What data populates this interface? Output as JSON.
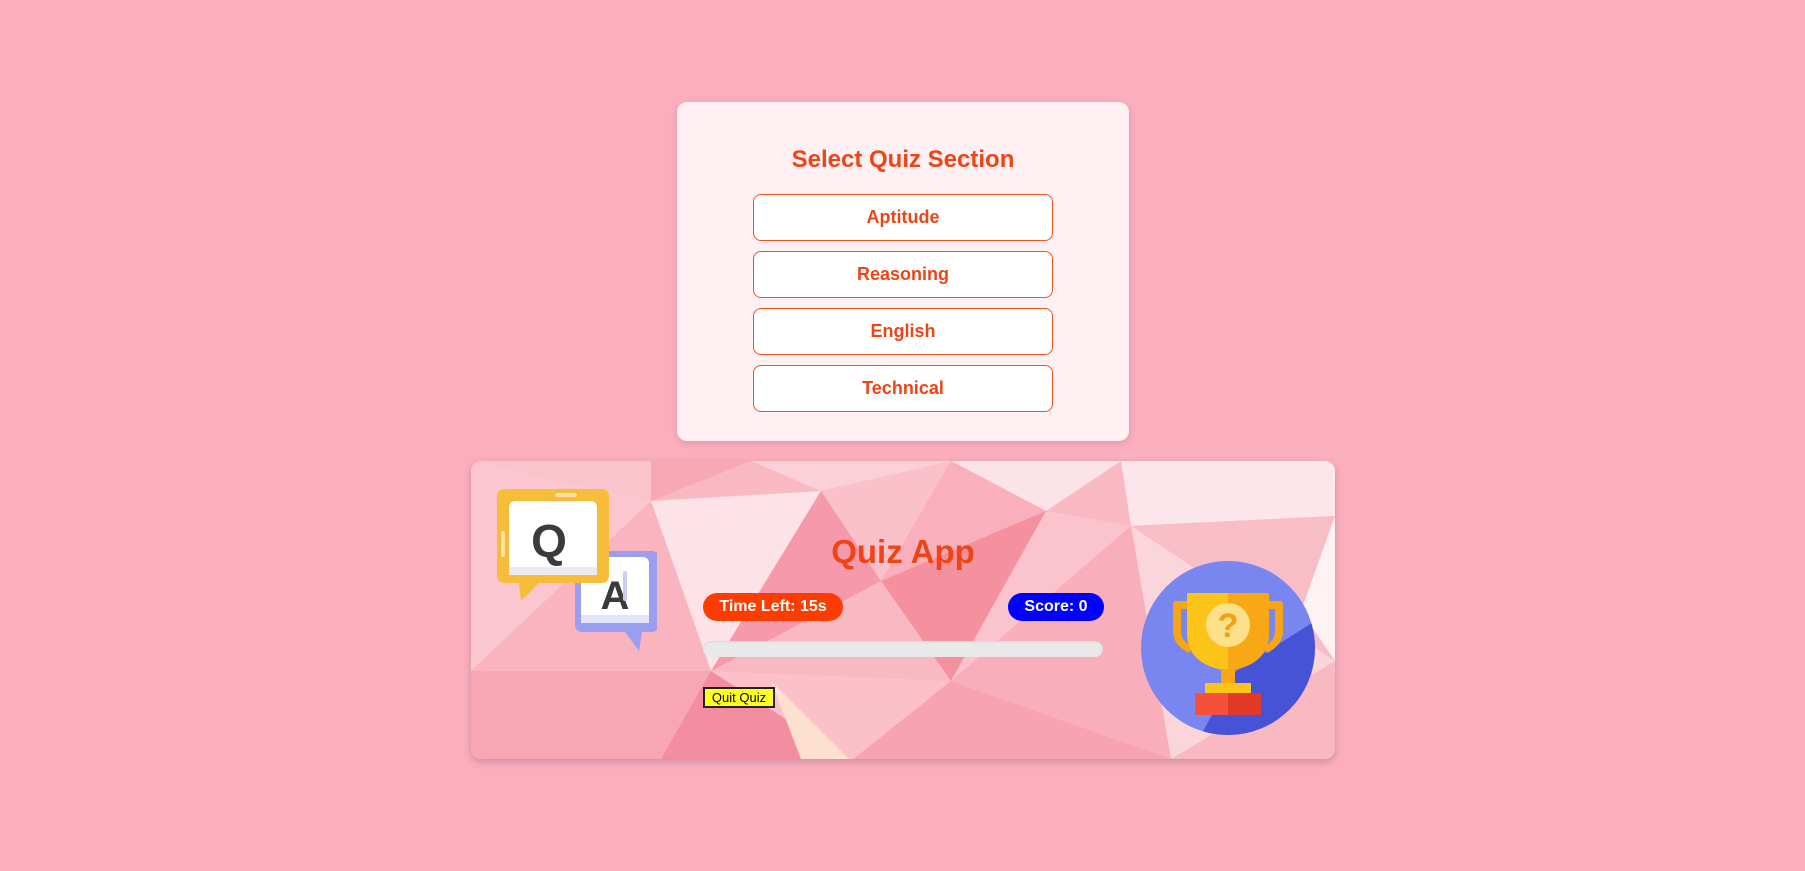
{
  "section_select": {
    "title": "Select Quiz Section",
    "options": [
      "Aptitude",
      "Reasoning",
      "English",
      "Technical"
    ]
  },
  "quiz": {
    "title": "Quiz App",
    "time_left": "Time Left: 15s",
    "score": "Score: 0",
    "progress_fraction": 0,
    "quit_label": "Quit Quiz"
  },
  "icons": {
    "left": "question-answer-bubbles-icon",
    "right": "trophy-question-icon"
  },
  "colors": {
    "page_background": "#fbaebe",
    "accent_orange": "#ef4416",
    "time_pill": "#ff3c00",
    "score_pill": "#0000ff",
    "quit_button": "#ffff22",
    "trophy_circle": "#4f5fe0",
    "trophy_gold": "#fbbf16"
  }
}
